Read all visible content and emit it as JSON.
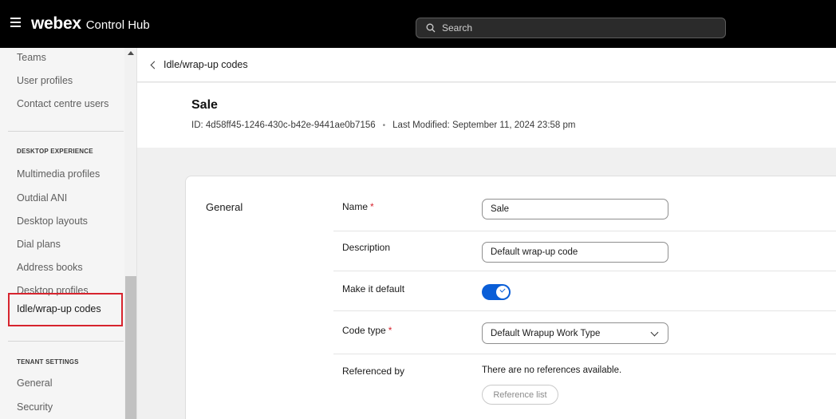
{
  "app": {
    "brand": "webex",
    "product": "Control Hub",
    "search_placeholder": "Search"
  },
  "sidebar": {
    "items_top": [
      "Teams",
      "User profiles",
      "Contact centre users"
    ],
    "desktop_section_title": "DESKTOP EXPERIENCE",
    "desktop_items": [
      "Multimedia profiles",
      "Outdial ANI",
      "Desktop layouts",
      "Dial plans",
      "Address books",
      "Desktop profiles"
    ],
    "active_item": "Idle/wrap-up codes",
    "tenant_section_title": "TENANT SETTINGS",
    "tenant_items": [
      "General",
      "Security"
    ]
  },
  "breadcrumb": {
    "back_label": "Idle/wrap-up codes"
  },
  "header": {
    "title": "Sale",
    "id_label": "ID:",
    "id_value": "4d58ff45-1246-430c-b42e-9441ae0b7156",
    "separator": "•",
    "modified_label": "Last Modified:",
    "modified_value": "September 11, 2024 23:58 pm"
  },
  "form": {
    "section_label": "General",
    "name_label": "Name",
    "name_value": "Sale",
    "required_mark": "*",
    "description_label": "Description",
    "description_value": "Default wrap-up code",
    "default_label": "Make it default",
    "default_on": true,
    "code_type_label": "Code type",
    "code_type_value": "Default Wrapup Work Type",
    "referenced_label": "Referenced by",
    "referenced_text": "There are no references available.",
    "reference_button": "Reference list"
  },
  "colors": {
    "topbar": "#000000",
    "accent_blue": "#0a5ed7",
    "required_red": "#d7242e",
    "highlight_red": "#d7242e"
  }
}
